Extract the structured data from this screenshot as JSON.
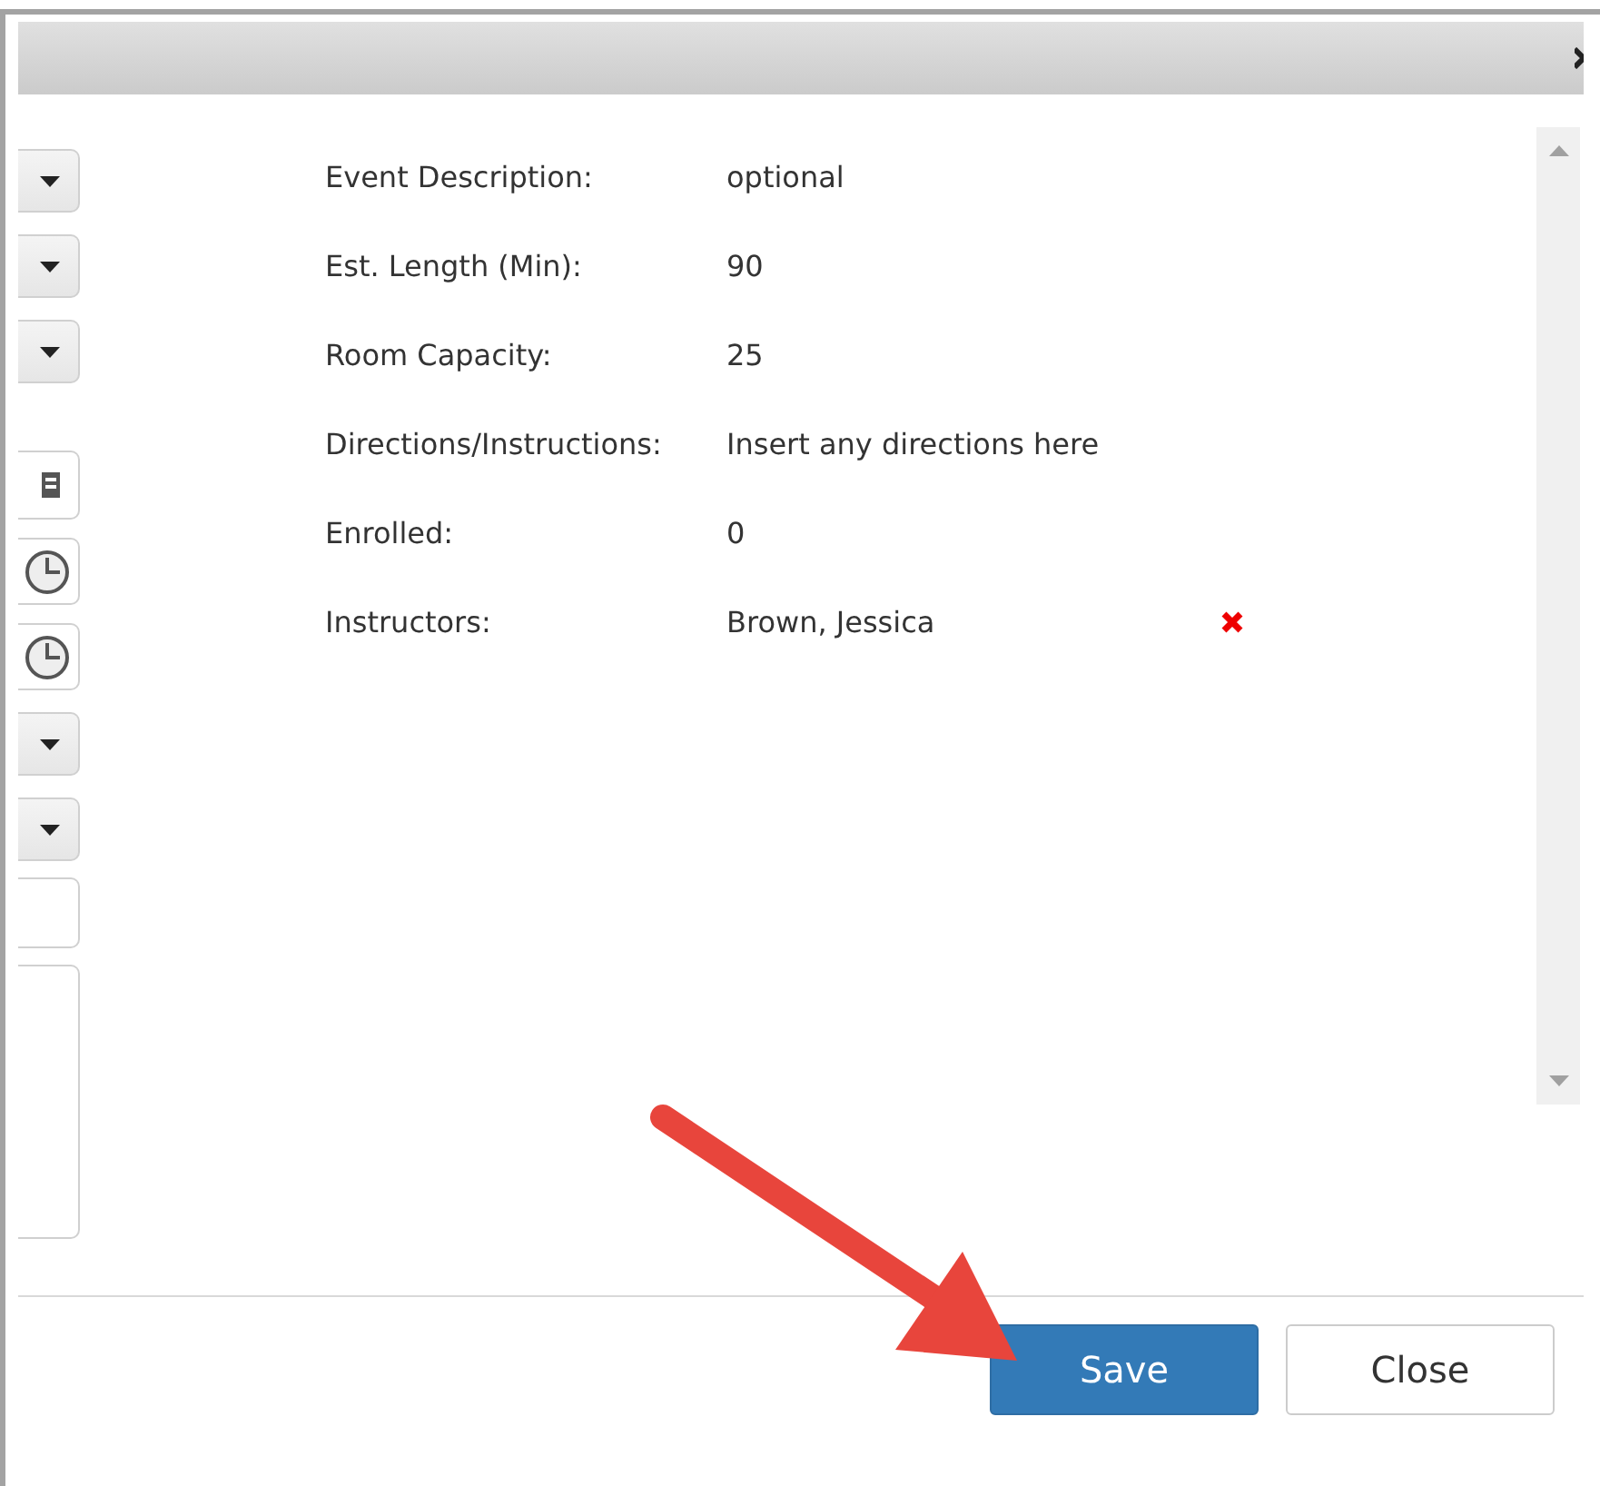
{
  "left_controls": [
    {
      "kind": "dropdown"
    },
    {
      "kind": "dropdown"
    },
    {
      "kind": "dropdown"
    },
    {
      "kind": "date"
    },
    {
      "kind": "time"
    },
    {
      "kind": "time"
    },
    {
      "kind": "dropdown"
    },
    {
      "kind": "dropdown"
    },
    {
      "kind": "text"
    },
    {
      "kind": "textarea"
    }
  ],
  "details": [
    {
      "label": "Event Description:",
      "value": "optional"
    },
    {
      "label": "Est. Length (Min):",
      "value": "90"
    },
    {
      "label": "Room Capacity:",
      "value": "25"
    },
    {
      "label": "Directions/Instructions:",
      "value": "Insert any directions here"
    },
    {
      "label": "Enrolled:",
      "value": "0"
    },
    {
      "label": "Instructors:",
      "value": "Brown, Jessica",
      "removable": true
    }
  ],
  "buttons": [
    {
      "label": "Save",
      "kind": "primary"
    },
    {
      "label": "Close",
      "kind": "secondary"
    }
  ]
}
